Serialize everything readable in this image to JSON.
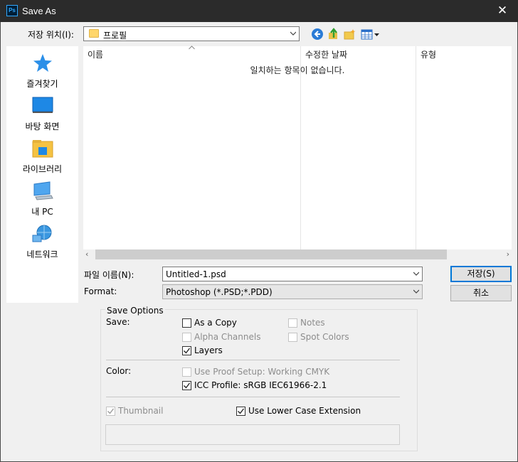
{
  "window": {
    "title": "Save As",
    "app_icon": "Ps",
    "close_glyph": "✕"
  },
  "location": {
    "label": "저장 위치(I):",
    "value": "프로필"
  },
  "places": [
    {
      "label": "즐겨찾기",
      "icon": "star-icon"
    },
    {
      "label": "바탕 화면",
      "icon": "desktop-icon"
    },
    {
      "label": "라이브러리",
      "icon": "library-icon"
    },
    {
      "label": "내 PC",
      "icon": "pc-icon"
    },
    {
      "label": "네트워크",
      "icon": "network-icon"
    }
  ],
  "filelist": {
    "columns": [
      "이름",
      "수정한 날짜",
      "유형"
    ],
    "empty_message": "일치하는 항목이 없습니다."
  },
  "filename": {
    "label": "파일 이름(N):",
    "value": "Untitled-1.psd"
  },
  "format": {
    "label": "Format:",
    "value": "Photoshop (*.PSD;*.PDD)"
  },
  "buttons": {
    "save": "저장(S)",
    "cancel": "취소"
  },
  "options": {
    "title": "Save Options",
    "save_label": "Save:",
    "color_label": "Color:",
    "as_a_copy": {
      "label": "As a Copy",
      "checked": false,
      "enabled": true
    },
    "notes": {
      "label": "Notes",
      "checked": false,
      "enabled": false
    },
    "alpha_channels": {
      "label": "Alpha Channels",
      "checked": false,
      "enabled": false
    },
    "spot_colors": {
      "label": "Spot Colors",
      "checked": false,
      "enabled": false
    },
    "layers": {
      "label": "Layers",
      "checked": true,
      "enabled": true
    },
    "use_proof_setup": {
      "label": "Use Proof Setup:  Working CMYK",
      "checked": false,
      "enabled": false
    },
    "icc_profile": {
      "label": "ICC Profile:  sRGB IEC61966-2.1",
      "checked": true,
      "enabled": true
    },
    "thumbnail": {
      "label": "Thumbnail",
      "checked": true,
      "enabled": false
    },
    "lower_case_ext": {
      "label": "Use Lower Case Extension",
      "checked": true,
      "enabled": true
    }
  },
  "colors": {
    "titlebar": "#2b2b2b",
    "accent": "#0078d7",
    "ps_blue": "#31a8ff"
  }
}
